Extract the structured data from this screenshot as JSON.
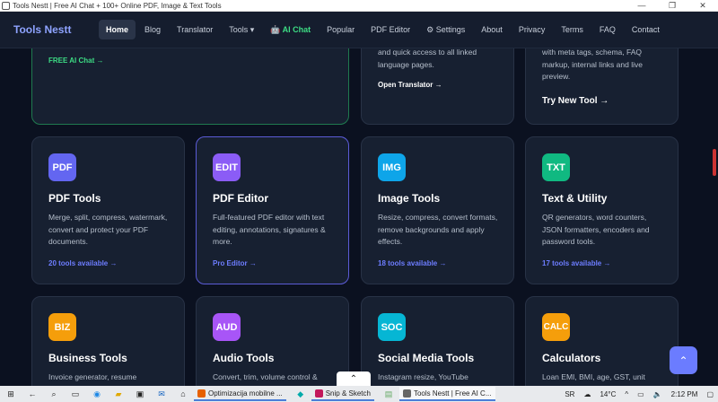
{
  "window": {
    "title": "Tools Nestt | Free AI Chat + 100+ Online PDF, Image & Text Tools",
    "minimize": "—",
    "restore": "❐",
    "close": "✕"
  },
  "nav": {
    "brand": "Tools Nestt",
    "items": [
      "Home",
      "Blog",
      "Translator",
      "Tools ▾",
      "AI Chat",
      "Popular",
      "PDF Editor",
      "Settings",
      "About",
      "Privacy",
      "Terms",
      "FAQ",
      "Contact"
    ]
  },
  "top_cards": {
    "left_link": "FREE AI Chat →",
    "mid_desc": "and quick access to all linked language pages.",
    "mid_link": "Open Translator →",
    "right_desc": "with meta tags, schema, FAQ markup, internal links and live preview.",
    "right_link": "Try New Tool →"
  },
  "cards": [
    {
      "icon": "PDF",
      "title": "PDF Tools",
      "desc": "Merge, split, compress, watermark, convert and protect your PDF documents.",
      "link": "20 tools available →",
      "color": "#6366f1"
    },
    {
      "icon": "EDIT",
      "title": "PDF Editor",
      "desc": "Full-featured PDF editor with text editing, annotations, signatures & more.",
      "link": "Pro Editor →",
      "color": "#8b5cf6"
    },
    {
      "icon": "IMG",
      "title": "Image Tools",
      "desc": "Resize, compress, convert formats, remove backgrounds and apply effects.",
      "link": "18 tools available →",
      "color": "#0ea5e9"
    },
    {
      "icon": "TXT",
      "title": "Text & Utility",
      "desc": "QR generators, word counters, JSON formatters, encoders and password tools.",
      "link": "17 tools available →",
      "color": "#10b981"
    },
    {
      "icon": "BIZ",
      "title": "Business Tools",
      "desc": "Invoice generator, resume",
      "link": "",
      "color": "#f59e0b"
    },
    {
      "icon": "AUD",
      "title": "Audio Tools",
      "desc": "Convert, trim, volume control &",
      "link": "",
      "color": "#a855f7"
    },
    {
      "icon": "SOC",
      "title": "Social Media Tools",
      "desc": "Instagram resize, YouTube",
      "link": "",
      "color": "#06b6d4"
    },
    {
      "icon": "CALC",
      "title": "Calculators",
      "desc": "Loan EMI, BMI, age, GST, unit",
      "link": "",
      "color": "#f59e0b"
    }
  ],
  "fab": "⌃",
  "download_tab": "⌃",
  "taskbar": {
    "apps": [
      "Optimizacija mobilne ...",
      "Snip & Sketch",
      "Tools Nestt | Free AI C..."
    ],
    "lang": "SR",
    "temp": "14°C",
    "time": "2:12 PM"
  }
}
